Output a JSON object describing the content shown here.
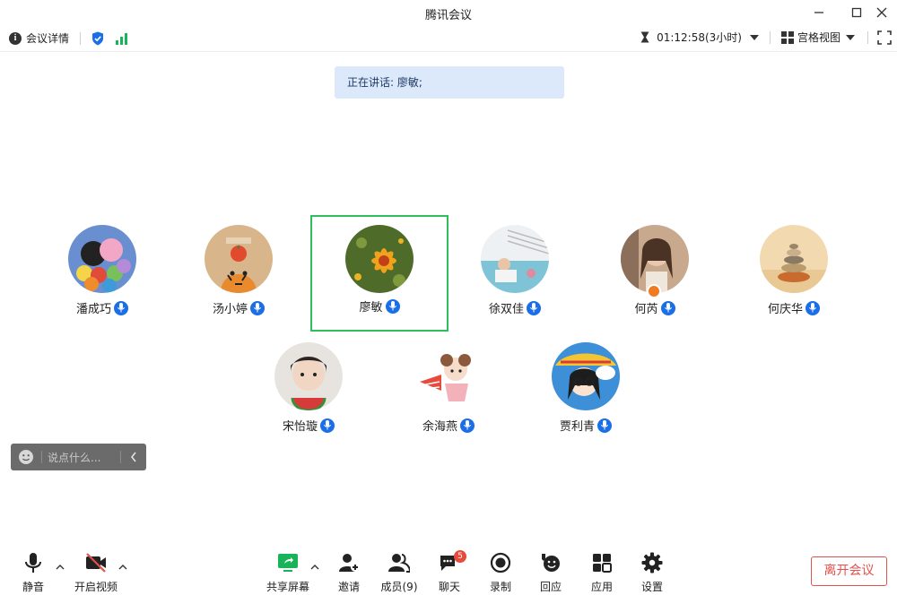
{
  "window": {
    "title": "腾讯会议"
  },
  "toolbar": {
    "meeting_info_label": "会议详情",
    "timer": "01:12:58(3小时)",
    "view_label": "宫格视图"
  },
  "speaking_banner": "正在讲话: 廖敏;",
  "participants": [
    {
      "name": "潘成巧"
    },
    {
      "name": "汤小婷"
    },
    {
      "name": "廖敏"
    },
    {
      "name": "徐双佳"
    },
    {
      "name": "何芮"
    },
    {
      "name": "何庆华"
    },
    {
      "name": "宋怡璇"
    },
    {
      "name": "余海燕"
    },
    {
      "name": "贾利青"
    }
  ],
  "chat": {
    "placeholder": "说点什么..."
  },
  "bottom": {
    "mute": "静音",
    "video": "开启视频",
    "share": "共享屏幕",
    "invite": "邀请",
    "members": "成员(9)",
    "chat": "聊天",
    "chat_badge": "5",
    "record": "录制",
    "replay": "回应",
    "apps": "应用",
    "settings": "设置",
    "leave": "离开会议"
  },
  "colors": {
    "accent": "#1a6ee8",
    "active_border": "#2fbe5e",
    "leave": "#e2514c",
    "share": "#19b35a"
  }
}
